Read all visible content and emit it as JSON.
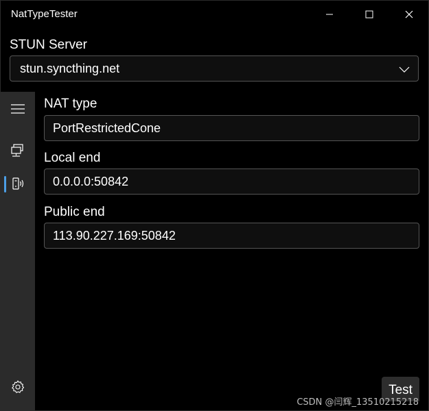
{
  "window": {
    "title": "NatTypeTester"
  },
  "stun": {
    "label": "STUN Server",
    "value": "stun.syncthing.net"
  },
  "nav": {
    "items": [
      {
        "icon": "hamburger-menu-icon"
      },
      {
        "icon": "network-icon"
      },
      {
        "icon": "nat-device-icon",
        "selected": true
      },
      {
        "icon": "gear-icon"
      }
    ]
  },
  "fields": {
    "nat_type": {
      "label": "NAT type",
      "value": "PortRestrictedCone"
    },
    "local_end": {
      "label": "Local end",
      "value": "0.0.0.0:50842"
    },
    "public_end": {
      "label": "Public end",
      "value": "113.90.227.169:50842"
    }
  },
  "actions": {
    "test_label": "Test"
  },
  "watermark": "CSDN @闫辉_13510215218",
  "colors": {
    "background": "#000000",
    "nav_pane": "#2b2b2b",
    "accent": "#4c9fe6",
    "border": "#555555"
  }
}
